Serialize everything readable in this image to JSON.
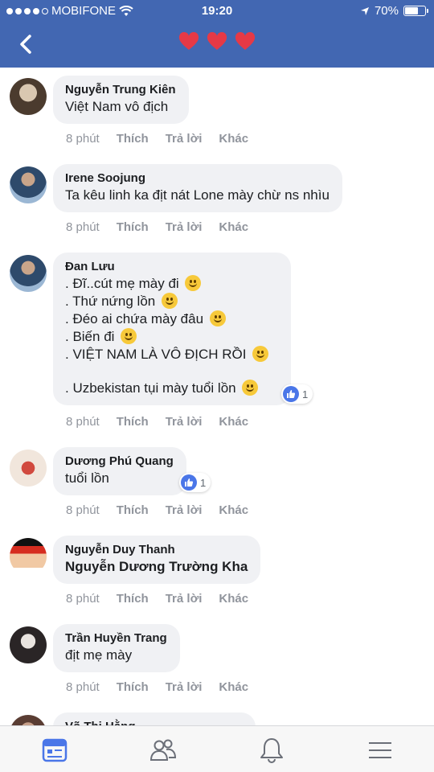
{
  "status": {
    "carrier": "MOBIFONE",
    "time": "19:20",
    "battery": "70%",
    "battery_level": 0.7
  },
  "header": {
    "title_icons": "heart-icons",
    "hearts": "❤️❤️❤️"
  },
  "comments": [
    {
      "author": "Nguyễn Trung Kiên",
      "lines": [
        "Việt Nam vô địch"
      ],
      "time": "8 phút",
      "like": "Thích",
      "reply": "Trả lời",
      "more": "Khác"
    },
    {
      "author": "Irene Soojung",
      "lines": [
        "Ta kêu linh ka địt nát Lone mày chừ ns nhìu"
      ],
      "time": "8 phút",
      "like": "Thích",
      "reply": "Trả lời",
      "more": "Khác"
    },
    {
      "author": "Đan Lưu",
      "lines": [
        ". Đĩ..cút mẹ mày đi",
        ". Thứ nứng lồn",
        ". Đéo ai chứa mày đâu",
        ". Biến đi",
        ". VIỆT NAM LÀ VÔ ĐỊCH RỒI",
        ". Uzbekistan tụi mày tuổi lồn"
      ],
      "reactions": "1",
      "time": "8 phút",
      "like": "Thích",
      "reply": "Trả lời",
      "more": "Khác"
    },
    {
      "author": "Dương Phú Quang",
      "lines": [
        "tuổi lồn"
      ],
      "reactions": "1",
      "time": "8 phút",
      "like": "Thích",
      "reply": "Trả lời",
      "more": "Khác"
    },
    {
      "author": "Nguyễn Duy Thanh",
      "lines": [
        "Nguyễn Dương Trường Kha"
      ],
      "time": "8 phút",
      "like": "Thích",
      "reply": "Trả lời",
      "more": "Khác"
    },
    {
      "author": "Trần Huyền Trang",
      "lines": [
        "địt mẹ mày"
      ],
      "time": "8 phút",
      "like": "Thích",
      "reply": "Trả lời",
      "more": "Khác"
    },
    {
      "author": "Võ Thị Hằng"
    }
  ],
  "colors": {
    "brand": "#4267b2",
    "bubble": "#f0f1f4",
    "muted": "#90949c",
    "like": "#4a76e8"
  }
}
